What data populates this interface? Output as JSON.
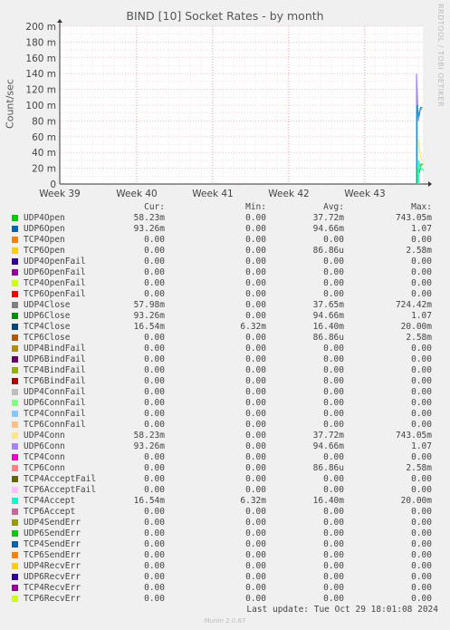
{
  "title": "BIND [10] Socket Rates - by month",
  "sidebar_text": "RRDTOOL / TOBI OETIKER",
  "chart_data": {
    "type": "line",
    "title": "BIND [10] Socket Rates - by month",
    "ylabel": "Count/sec",
    "xlabel": "",
    "x_ticks": [
      "Week 39",
      "Week 40",
      "Week 41",
      "Week 42",
      "Week 43"
    ],
    "y_ticks": [
      "0",
      "20 m",
      "40 m",
      "60 m",
      "80 m",
      "100 m",
      "120 m",
      "140 m",
      "160 m",
      "180 m",
      "200 m"
    ],
    "ylim": [
      0,
      200
    ],
    "y_unit": "m",
    "grid": true,
    "series": [
      {
        "name": "UDP6Conn",
        "color": "#9f8af0",
        "spike": [
          140,
          80,
          95
        ]
      },
      {
        "name": "UDP6Open",
        "color": "#1e90c8",
        "spike": [
          100,
          85,
          97
        ]
      },
      {
        "name": "UDP4Open",
        "color": "#00cc00",
        "spike": [
          20,
          15,
          25
        ]
      },
      {
        "name": "UDP4Conn",
        "color": "#ffe080",
        "spike": [
          60,
          40,
          30
        ]
      },
      {
        "name": "TCP4Accept",
        "color": "#33eeaa",
        "spike": [
          30,
          20,
          18
        ]
      }
    ]
  },
  "legend": {
    "headers": [
      "Cur:",
      "Min:",
      "Avg:",
      "Max:"
    ],
    "rows": [
      {
        "name": "UDP4Open",
        "color": "#00cc00",
        "cur": "58.23m",
        "min": "0.00",
        "avg": "37.72m",
        "max": "743.05m"
      },
      {
        "name": "UDP6Open",
        "color": "#0066b3",
        "cur": "93.26m",
        "min": "0.00",
        "avg": "94.66m",
        "max": "1.07"
      },
      {
        "name": "TCP4Open",
        "color": "#ff8000",
        "cur": "0.00",
        "min": "0.00",
        "avg": "0.00",
        "max": "0.00"
      },
      {
        "name": "TCP6Open",
        "color": "#ffcc00",
        "cur": "0.00",
        "min": "0.00",
        "avg": "86.86u",
        "max": "2.58m"
      },
      {
        "name": "UDP4OpenFail",
        "color": "#330099",
        "cur": "0.00",
        "min": "0.00",
        "avg": "0.00",
        "max": "0.00"
      },
      {
        "name": "UDP6OpenFail",
        "color": "#990099",
        "cur": "0.00",
        "min": "0.00",
        "avg": "0.00",
        "max": "0.00"
      },
      {
        "name": "TCP4OpenFail",
        "color": "#ccff00",
        "cur": "0.00",
        "min": "0.00",
        "avg": "0.00",
        "max": "0.00"
      },
      {
        "name": "TCP6OpenFail",
        "color": "#ff0000",
        "cur": "0.00",
        "min": "0.00",
        "avg": "0.00",
        "max": "0.00"
      },
      {
        "name": "UDP4Close",
        "color": "#808080",
        "cur": "57.98m",
        "min": "0.00",
        "avg": "37.65m",
        "max": "724.42m"
      },
      {
        "name": "UDP6Close",
        "color": "#008f00",
        "cur": "93.26m",
        "min": "0.00",
        "avg": "94.66m",
        "max": "1.07"
      },
      {
        "name": "TCP4Close",
        "color": "#00487d",
        "cur": "16.54m",
        "min": "6.32m",
        "avg": "16.40m",
        "max": "20.00m"
      },
      {
        "name": "TCP6Close",
        "color": "#b35a00",
        "cur": "0.00",
        "min": "0.00",
        "avg": "86.86u",
        "max": "2.58m"
      },
      {
        "name": "UDP4BindFail",
        "color": "#b38f00",
        "cur": "0.00",
        "min": "0.00",
        "avg": "0.00",
        "max": "0.00"
      },
      {
        "name": "UDP6BindFail",
        "color": "#6b006b",
        "cur": "0.00",
        "min": "0.00",
        "avg": "0.00",
        "max": "0.00"
      },
      {
        "name": "TCP4BindFail",
        "color": "#8fb300",
        "cur": "0.00",
        "min": "0.00",
        "avg": "0.00",
        "max": "0.00"
      },
      {
        "name": "TCP6BindFail",
        "color": "#b30000",
        "cur": "0.00",
        "min": "0.00",
        "avg": "0.00",
        "max": "0.00"
      },
      {
        "name": "UDP4ConnFail",
        "color": "#bebebe",
        "cur": "0.00",
        "min": "0.00",
        "avg": "0.00",
        "max": "0.00"
      },
      {
        "name": "UDP6ConnFail",
        "color": "#80ff80",
        "cur": "0.00",
        "min": "0.00",
        "avg": "0.00",
        "max": "0.00"
      },
      {
        "name": "TCP4ConnFail",
        "color": "#80c9ff",
        "cur": "0.00",
        "min": "0.00",
        "avg": "0.00",
        "max": "0.00"
      },
      {
        "name": "TCP6ConnFail",
        "color": "#ffc080",
        "cur": "0.00",
        "min": "0.00",
        "avg": "0.00",
        "max": "0.00"
      },
      {
        "name": "UDP4Conn",
        "color": "#ffe680",
        "cur": "58.23m",
        "min": "0.00",
        "avg": "37.72m",
        "max": "743.05m"
      },
      {
        "name": "UDP6Conn",
        "color": "#aa80ff",
        "cur": "93.26m",
        "min": "0.00",
        "avg": "94.66m",
        "max": "1.07"
      },
      {
        "name": "TCP4Conn",
        "color": "#ee00cc",
        "cur": "0.00",
        "min": "0.00",
        "avg": "0.00",
        "max": "0.00"
      },
      {
        "name": "TCP6Conn",
        "color": "#ff8080",
        "cur": "0.00",
        "min": "0.00",
        "avg": "86.86u",
        "max": "2.58m"
      },
      {
        "name": "TCP4AcceptFail",
        "color": "#666600",
        "cur": "0.00",
        "min": "0.00",
        "avg": "0.00",
        "max": "0.00"
      },
      {
        "name": "TCP6AcceptFail",
        "color": "#ffbfff",
        "cur": "0.00",
        "min": "0.00",
        "avg": "0.00",
        "max": "0.00"
      },
      {
        "name": "TCP4Accept",
        "color": "#00ffcc",
        "cur": "16.54m",
        "min": "6.32m",
        "avg": "16.40m",
        "max": "20.00m"
      },
      {
        "name": "TCP6Accept",
        "color": "#cc6699",
        "cur": "0.00",
        "min": "0.00",
        "avg": "0.00",
        "max": "0.00"
      },
      {
        "name": "UDP4SendErr",
        "color": "#999900",
        "cur": "0.00",
        "min": "0.00",
        "avg": "0.00",
        "max": "0.00"
      },
      {
        "name": "UDP6SendErr",
        "color": "#00cc00",
        "cur": "0.00",
        "min": "0.00",
        "avg": "0.00",
        "max": "0.00"
      },
      {
        "name": "TCP4SendErr",
        "color": "#0066b3",
        "cur": "0.00",
        "min": "0.00",
        "avg": "0.00",
        "max": "0.00"
      },
      {
        "name": "TCP6SendErr",
        "color": "#ff8000",
        "cur": "0.00",
        "min": "0.00",
        "avg": "0.00",
        "max": "0.00"
      },
      {
        "name": "UDP4RecvErr",
        "color": "#ffcc00",
        "cur": "0.00",
        "min": "0.00",
        "avg": "0.00",
        "max": "0.00"
      },
      {
        "name": "UDP6RecvErr",
        "color": "#330099",
        "cur": "0.00",
        "min": "0.00",
        "avg": "0.00",
        "max": "0.00"
      },
      {
        "name": "TCP4RecvErr",
        "color": "#990099",
        "cur": "0.00",
        "min": "0.00",
        "avg": "0.00",
        "max": "0.00"
      },
      {
        "name": "TCP6RecvErr",
        "color": "#ccff00",
        "cur": "0.00",
        "min": "0.00",
        "avg": "0.00",
        "max": "0.00"
      }
    ]
  },
  "last_update": "Last update: Tue Oct 29 18:01:08 2024",
  "footer": "Munin 2.0.67"
}
